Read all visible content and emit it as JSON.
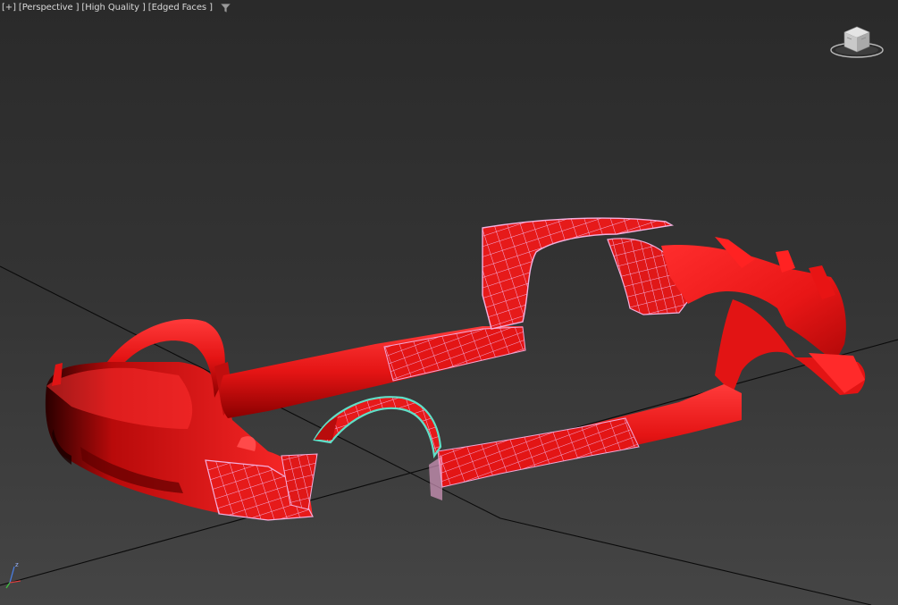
{
  "viewport": {
    "labels": {
      "plus": "[+]",
      "view": "[Perspective ]",
      "shading": "[High Quality ]",
      "display": "[Edged Faces ]"
    },
    "filter_icon": "funnel-filter-icon",
    "viewcube_icon": "viewcube-navigation-icon",
    "axis_icon": "world-axis-tripod-icon",
    "axis_labels": {
      "z": "z"
    }
  },
  "scene": {
    "objects": [
      "rear-bumper",
      "rear-fender-flare",
      "left-side-skirt",
      "right-side-skirt",
      "front-fender-flare",
      "front-bumper"
    ],
    "body_color": "#e01414",
    "wire_color": "#f0a2d8",
    "selected_edge_color": "#5fe0c8",
    "grid_line_color": "#0a0a0a"
  }
}
